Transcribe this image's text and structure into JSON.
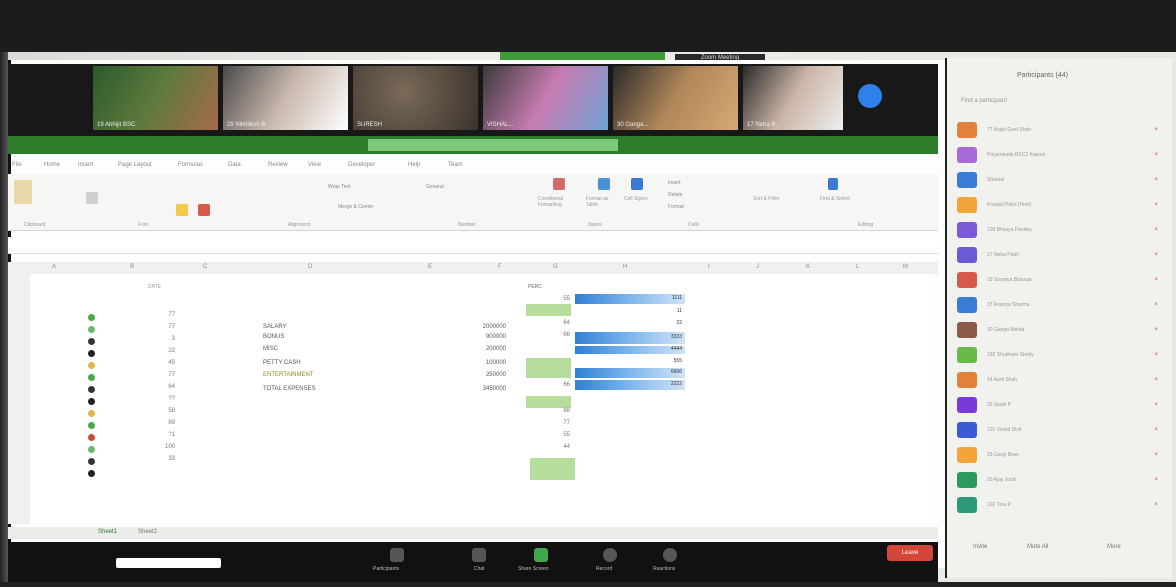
{
  "window": {
    "title": "Zoom Meeting"
  },
  "videos": [
    {
      "name": "19 Abhijit BSC"
    },
    {
      "name": "29 Nikhilesh B."
    },
    {
      "name": "SURESH"
    },
    {
      "name": "VISHAL..."
    },
    {
      "name": "30 Ganga..."
    },
    {
      "name": "17 Neha B."
    }
  ],
  "menu": [
    "File",
    "Home",
    "Insert",
    "Page Layout",
    "Formulas",
    "Data",
    "Review",
    "View",
    "Developer",
    "Help",
    "Team"
  ],
  "ribbon": {
    "wrap_text": "Wrap Text",
    "merge": "Merge & Center",
    "number_format": "General",
    "conditional": "Conditional Formatting",
    "format_table": "Format as Table",
    "cell_styles": "Cell Styles",
    "insert": "Insert",
    "delete": "Delete",
    "format": "Format",
    "sort": "Sort & Filter",
    "find": "Find & Select",
    "groups": [
      "Clipboard",
      "Font",
      "Alignment",
      "Number",
      "Styles",
      "Cells",
      "Editing"
    ]
  },
  "columns": [
    "A",
    "B",
    "C",
    "D",
    "E",
    "F",
    "G",
    "H",
    "I",
    "J",
    "K",
    "L",
    "M"
  ],
  "sheet": {
    "g_header": "PERC",
    "b_header": "DATE",
    "b_values": [
      "77",
      "77",
      "3",
      "22",
      "45",
      "77",
      "64",
      "??",
      "58",
      "89",
      "?1",
      "100",
      "33"
    ],
    "expenses": [
      {
        "label": "SALARY",
        "amount": "2000000"
      },
      {
        "label": "BONUS",
        "amount": "900000"
      },
      {
        "label": "MISC",
        "amount": "200000"
      },
      {
        "label": "PETTY CASH",
        "amount": "100000"
      },
      {
        "label": "ENTERTAINMENT",
        "amount": "250000"
      },
      {
        "label": "TOTAL EXPENSES",
        "amount": "3450000"
      }
    ],
    "g_values": [
      "55",
      "",
      "64",
      "66",
      "",
      "",
      "66",
      "",
      "88",
      "77",
      "55",
      "44"
    ],
    "bar_values": [
      "1111",
      "11",
      "22",
      "3333",
      "4444",
      "555",
      "6666",
      "2222"
    ]
  },
  "sheet_tabs": [
    "Sheet1",
    "Sheet2"
  ],
  "zoom_controls": [
    {
      "label": "Participants"
    },
    {
      "label": "Chat"
    },
    {
      "label": "Share Screen"
    },
    {
      "label": "Record"
    },
    {
      "label": "Reactions"
    }
  ],
  "leave_label": "Leave",
  "participants_panel": {
    "title": "Participants (44)",
    "search_placeholder": "Find a participant",
    "people": [
      "77 Anjali Goel Shah",
      "Priyambada BSC2 Kapoor",
      "Sheetal",
      "Pranjali Patel (Host)",
      "100 Bhavya Pandey",
      "17 Neha Patel",
      "33 Soumya Bhavsar",
      "37 Ananya Sharma",
      "30 Ganga Mehta",
      "192 Shubham Shetty",
      "14 Aarti Shah",
      "25 Swati P",
      "101 Vishal Dixit",
      "15 Gargi Bose",
      "20 Ajay Joshi",
      "102 Tina P"
    ],
    "footer": [
      "Invite",
      "Mute All",
      "More"
    ]
  },
  "colors": {
    "accent": "#2b7d2a",
    "fill_green": "#b7dd9d",
    "bar_blue": "#2f7fd6",
    "leave": "#d3473b"
  }
}
